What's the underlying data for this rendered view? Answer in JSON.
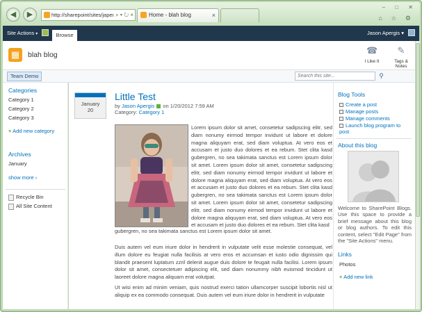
{
  "browser": {
    "address": "http://sharepoint/sites/japerg",
    "address_controls": "⌕ ▾ ↻ ×",
    "active_tab": "Home - blah blog",
    "window_controls": "– □ ✕",
    "toolbar_icons": "⌂ ☆ ⚙"
  },
  "ribbon": {
    "site_actions": "Site Actions",
    "browse_tab": "Browse",
    "user": "Jason Apergis ▾"
  },
  "site": {
    "title": "blah blog",
    "like_it": "I Like It",
    "tags_notes": "Tags & Notes"
  },
  "topnav": {
    "team": "Team Demo",
    "search_placeholder": "Search this site..."
  },
  "leftnav": {
    "categories_heading": "Categories",
    "categories": [
      "Category 1",
      "Category 2",
      "Category 3"
    ],
    "add_category": "Add new category",
    "archives_heading": "Archives",
    "archives": [
      "January"
    ],
    "show_more": "show more ›",
    "recycle_bin": "Recycle Bin",
    "all_site_content": "All Site Content"
  },
  "post": {
    "month": "January",
    "day": "20",
    "title": "Little Test",
    "by_label": "by",
    "author": "Jason Apergis",
    "on_label": "on",
    "datetime": "1/20/2012 7:59 AM",
    "category_label": "Category:",
    "category": "Category 1",
    "para1_wrap": "Lorem ipsum dolor sit amet, consetetur sadipscing elitr, sed diam nonumy eirmod tempor invidunt ut labore et dolore magna aliquyam erat, sed diam voluptua. At vero eos et accusam et justo duo dolores et ea rebum. Stet clita kasd gubergren, no sea takimata sanctus est Lorem ipsum dolor sit amet. Lorem ipsum dolor sit amet, consetetur sadipscing elitr, sed diam nonumy eirmod tempor invidunt ut labore et dolore magna aliquyam erat, sed diam voluptua. At vero eos et accusam et justo duo dolores et ea rebum. Stet clita kasd gubergren, no sea takimata sanctus est Lorem ipsum dolor sit amet. Lorem ipsum dolor sit amet, consetetur sadipscing elitr, sed diam nonumy eirmod tempor invidunt ut labore et dolore magna aliquyam erat, sed diam voluptua. At vero eos et accusam et justo duo dolores et ea rebum. Stet clita kasd",
    "para1_tail": "gubergren, no sea takimata sanctus est Lorem ipsum dolor sit amet.",
    "para2": "Duis autem vel eum iriure dolor in hendrerit in vulputate velit esse molestie consequat, vel illum dolore eu feugiat nulla facilisis at vero eros et accumsan et iusto odio dignissim qui blandit praesent luptatum zzril delenit augue duis dolore te feugait nulla facilisi. Lorem ipsum dolor sit amet, consectetuer adipiscing elit, sed diam nonummy nibh euismod tincidunt ut laoreet dolore magna aliquam erat volutpat.",
    "para3": "Ut wisi enim ad minim veniam, quis nostrud exerci tation ullamcorper suscipit lobortis nisl ut aliquip ex ea commodo consequat. Duis autem vel eum iriure dolor in hendrerit in vulputate"
  },
  "rightcol": {
    "tools_heading": "Blog Tools",
    "tools": [
      "Create a post",
      "Manage posts",
      "Manage comments",
      "Launch blog program to post"
    ],
    "about_heading": "About this blog",
    "about_text": "Welcome to SharePoint Blogs. Use this space to provide a brief message about this blog or blog authors. To edit this content, select \"Edit Page\" from the \"Site Actions\" menu.",
    "links_heading": "Links",
    "links": [
      "Photos"
    ],
    "add_link": "Add new link"
  }
}
